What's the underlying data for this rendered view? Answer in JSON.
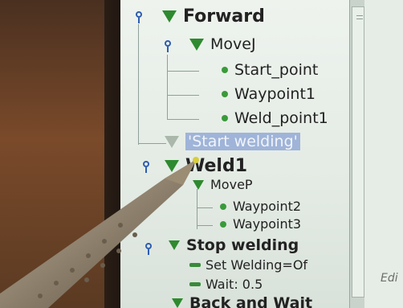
{
  "tree": {
    "forward": "Forward",
    "movej": "MoveJ",
    "start_point": "Start_point",
    "waypoint1": "Waypoint1",
    "weld_point1": "Weld_point1",
    "start_welding": "'Start welding'",
    "weld1": "Weld1",
    "movep": "MoveP",
    "waypoint2": "Waypoint2",
    "waypoint3": "Waypoint3",
    "stop_welding": "Stop welding",
    "set_welding": "Set Welding=Of",
    "wait": "Wait: 0.5",
    "back_and_wait": "Back and Wait"
  },
  "right_panel": {
    "hint": "Edi"
  },
  "colors": {
    "node_green": "#2e8a2e",
    "pin_blue": "#2e5db0",
    "selection": "#9fb4d8"
  }
}
